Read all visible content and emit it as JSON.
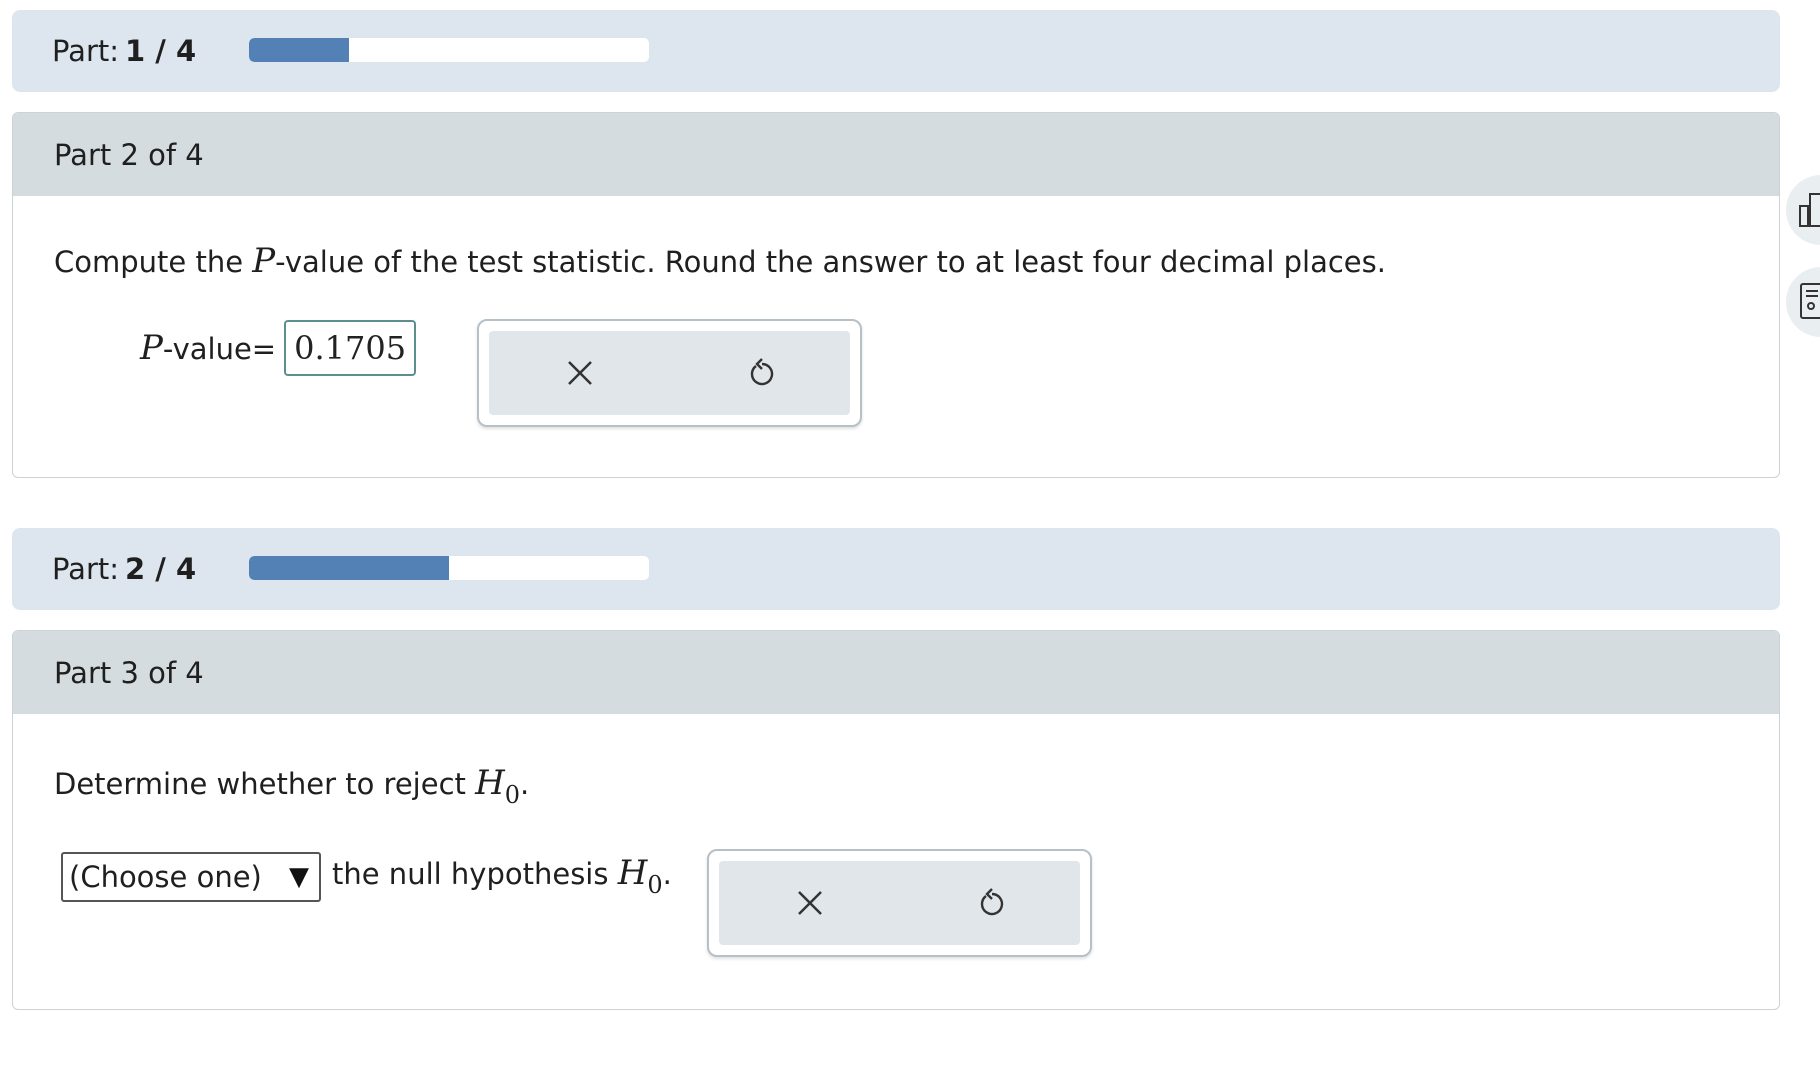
{
  "progress": [
    {
      "label": "Part:",
      "value": "1 / 4",
      "fraction": 0.25
    },
    {
      "label": "Part:",
      "value": "2 / 4",
      "fraction": 0.5
    }
  ],
  "parts": {
    "part2": {
      "header": "Part 2 of 4",
      "prompt_before": "Compute the ",
      "prompt_var": "P",
      "prompt_after": "-value of the test statistic. Round the answer to at least four decimal places.",
      "answer_var": "P",
      "answer_label": "-value",
      "answer_eq": "=",
      "answer_value": "0.1705"
    },
    "part3": {
      "header": "Part 3 of 4",
      "prompt_before": "Determine whether to reject ",
      "prompt_var": "H",
      "prompt_sub": "0",
      "prompt_after": ".",
      "select_value": "(Choose one)",
      "select_arrow": "▼",
      "sentence_after": "the null hypothesis ",
      "sentence_var": "H",
      "sentence_sub": "0",
      "sentence_end": "."
    }
  },
  "icons": {
    "clear": "close-icon",
    "undo": "undo-icon",
    "side_top": "bar-chart-icon",
    "side_bottom": "calculator-icon"
  },
  "colors": {
    "progress_fill": "#5380b5",
    "banner_bg": "#dde6ee",
    "header_bg": "#d5dce0",
    "input_border": "#5d8e8e"
  }
}
